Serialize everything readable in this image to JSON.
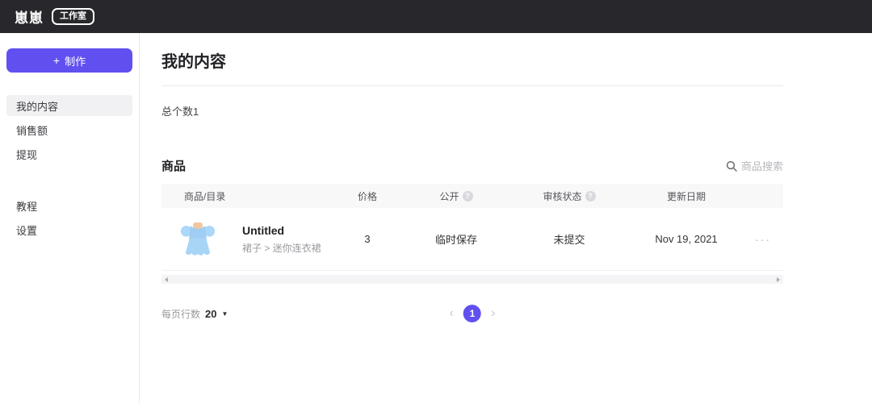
{
  "topbar": {
    "logo": "崽崽",
    "badge": "工作室",
    "bg_color": "#28282C"
  },
  "sidebar": {
    "create_button": {
      "icon": "+",
      "label": "制作"
    },
    "menu_primary": [
      {
        "label": "我的内容",
        "active": true
      },
      {
        "label": "销售额",
        "active": false
      },
      {
        "label": "提现",
        "active": false
      }
    ],
    "menu_secondary": [
      {
        "label": "教程",
        "active": false
      },
      {
        "label": "设置",
        "active": false
      }
    ]
  },
  "main": {
    "page_title": "我的内容",
    "total_count_label": "总个数1",
    "products_section_title": "商品",
    "search_label": "商品搜索",
    "table": {
      "col_product": "商品/目录",
      "col_price": "价格",
      "col_public": "公开",
      "col_review": "审核状态",
      "col_updated": "更新日期",
      "help_glyph": "?",
      "row": {
        "name": "Untitled",
        "category_path": "裙子 > 迷你连衣裙",
        "price": "3",
        "public_status": "临时保存",
        "review_status": "未提交",
        "updated_date": "Nov 19, 2021",
        "actions_glyph": "···"
      }
    },
    "pagination": {
      "rows_per_page_label": "每页行数",
      "rows_per_page_value": "20",
      "caret_glyph": "▼",
      "prev_glyph": "‹",
      "page": "1",
      "next_glyph": "›"
    }
  },
  "colors": {
    "accent": "#6150F0",
    "thumbnail_dress": "#A8D4F6"
  }
}
